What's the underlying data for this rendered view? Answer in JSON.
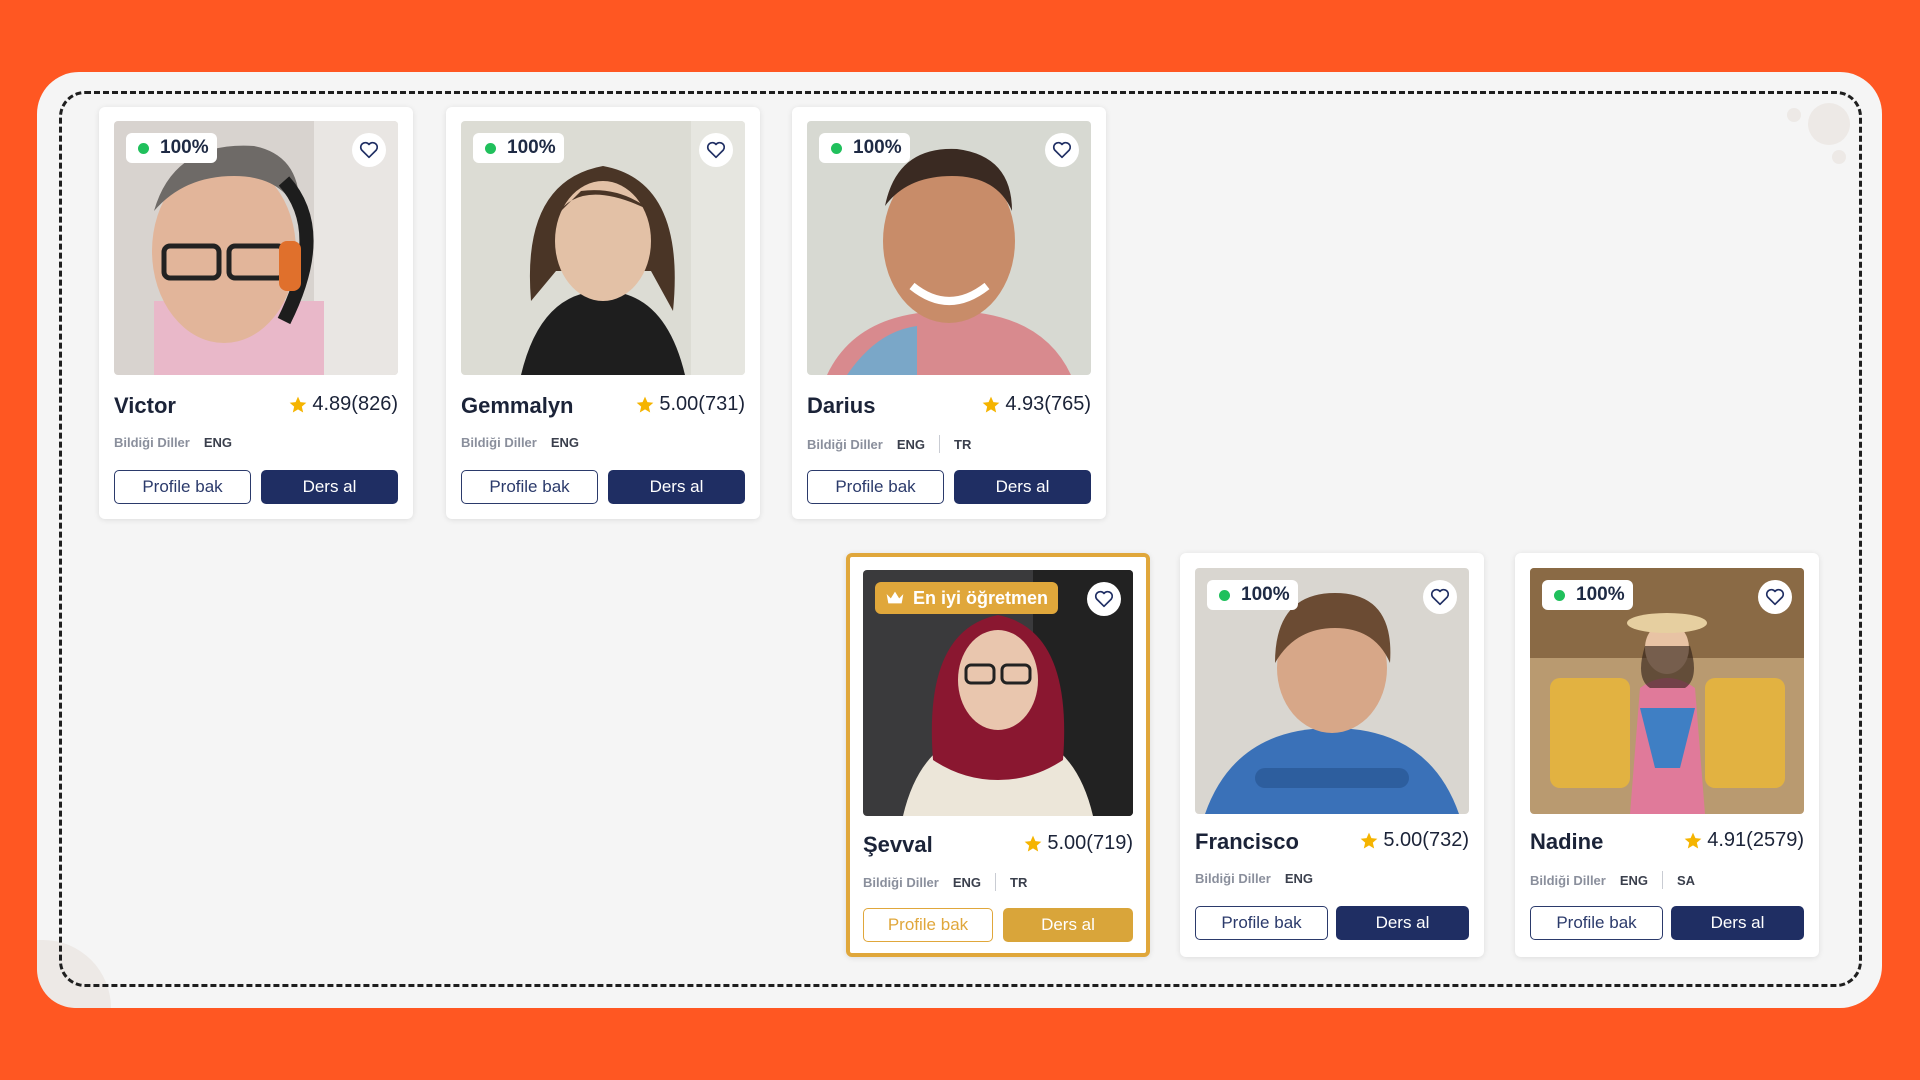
{
  "colors": {
    "background": "#ff5722",
    "panel": "#f5f5f5",
    "primary_button": "#1f2e63",
    "gold": "#e0a73b",
    "online_dot": "#20c05c",
    "star": "#f5b400"
  },
  "labels": {
    "languages_label": "Bildiği Diller",
    "profile_button": "Profile bak",
    "book_button": "Ders al",
    "best_teacher_badge": "En iyi öğretmen"
  },
  "icons": {
    "favorite": "heart-icon",
    "rating": "star-icon",
    "online": "online-dot-icon",
    "best": "crown-icon"
  },
  "teachers": [
    {
      "name": "Victor",
      "rating": "4.89(826)",
      "availability": "100%",
      "languages": [
        "ENG"
      ]
    },
    {
      "name": "Gemmalyn",
      "rating": "5.00(731)",
      "availability": "100%",
      "languages": [
        "ENG"
      ]
    },
    {
      "name": "Darius",
      "rating": "4.93(765)",
      "availability": "100%",
      "languages": [
        "ENG",
        "TR"
      ]
    },
    {
      "name": "Şevval",
      "rating": "5.00(719)",
      "featured": true,
      "languages": [
        "ENG",
        "TR"
      ]
    },
    {
      "name": "Francisco",
      "rating": "5.00(732)",
      "availability": "100%",
      "languages": [
        "ENG"
      ]
    },
    {
      "name": "Nadine",
      "rating": "4.91(2579)",
      "availability": "100%",
      "languages": [
        "ENG",
        "SA"
      ]
    }
  ]
}
